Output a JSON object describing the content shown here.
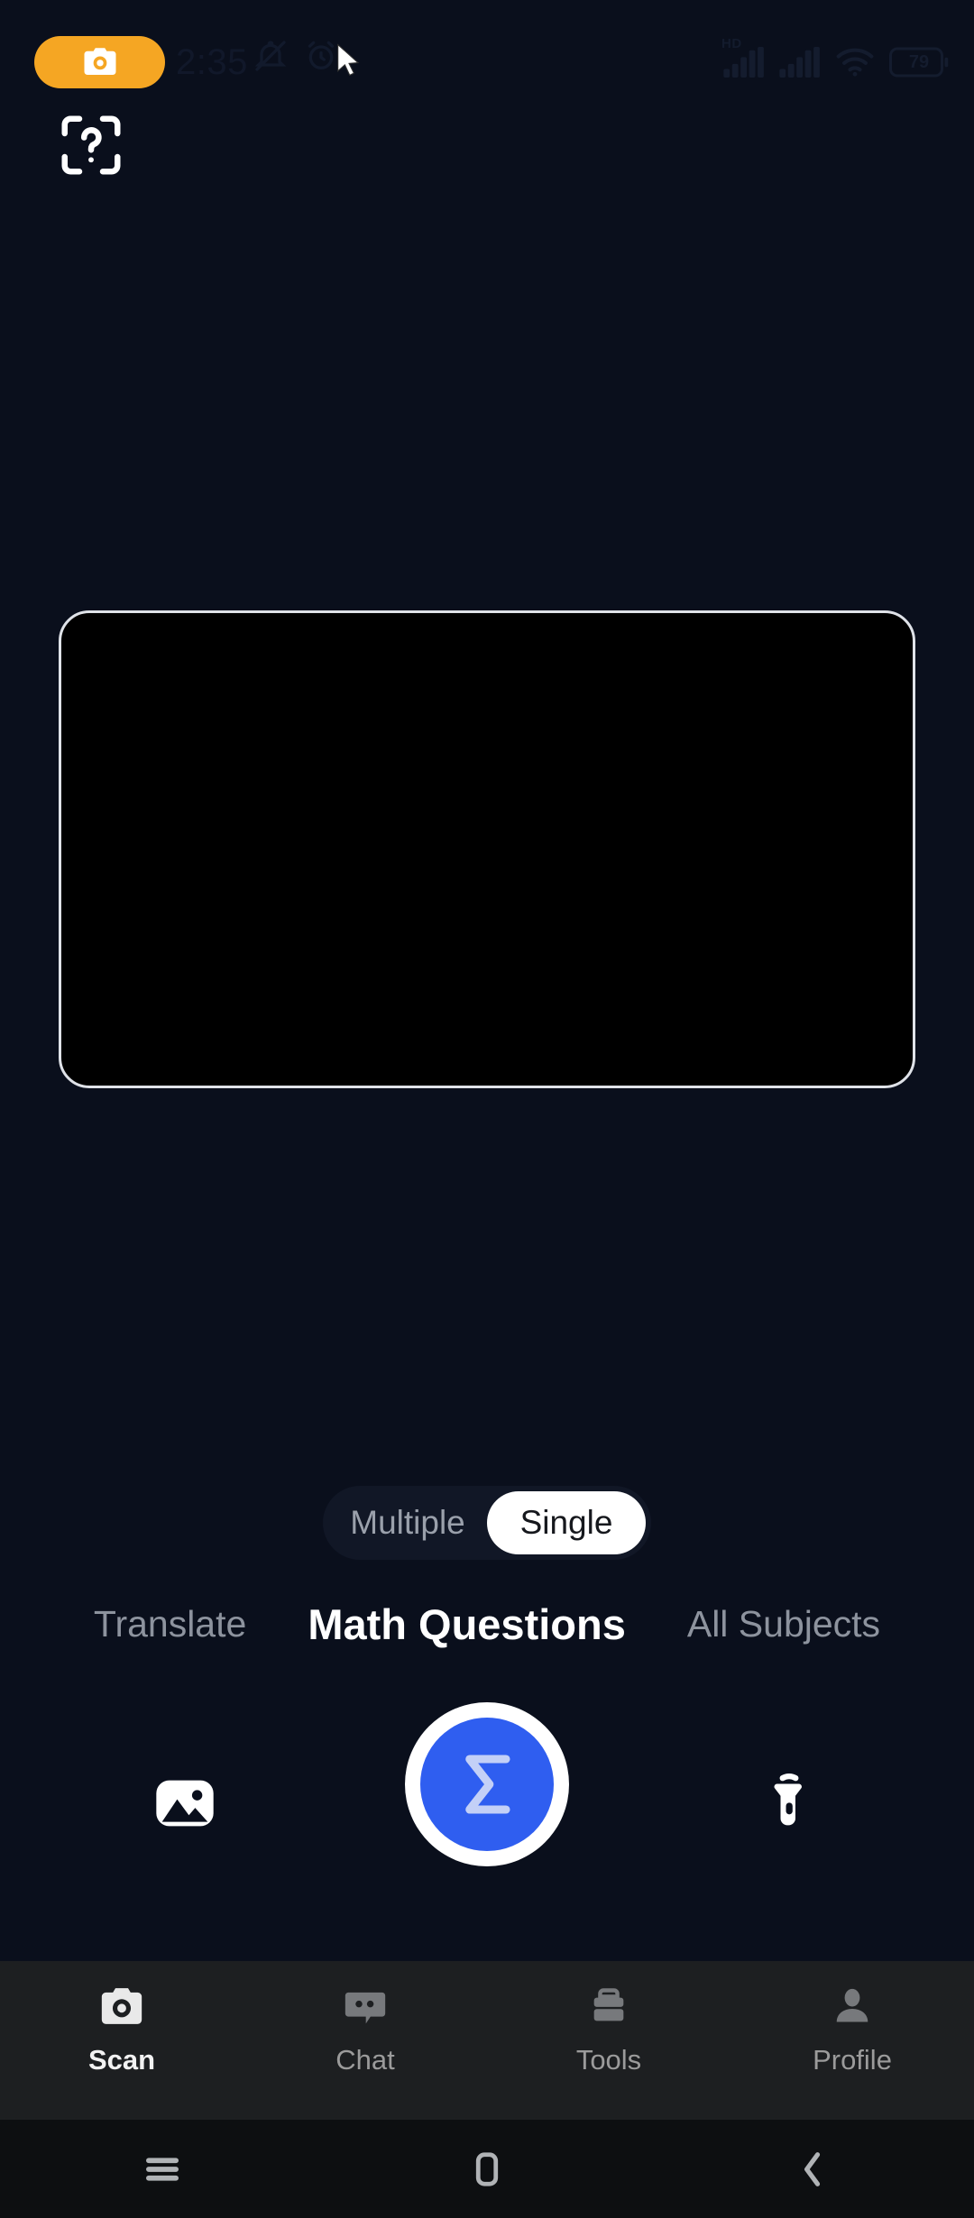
{
  "statusbar": {
    "time": "2:35",
    "camera_badge_icon": "camera-icon",
    "silent_icon": "bell-off-icon",
    "alarm_icon": "alarm-clock-icon",
    "cursor_icon": "mouse-cursor-icon",
    "hd_label": "HD",
    "signal_icon": "cellular-signal-icon",
    "signal2_icon": "cellular-signal-2-icon",
    "wifi_icon": "wifi-icon",
    "battery_level": "79"
  },
  "overlay": {
    "scan_help_icon": "scan-question-icon"
  },
  "viewfinder": {
    "frame_name": "camera-viewfinder-frame"
  },
  "capture_mode_toggle": {
    "options": [
      {
        "label": "Multiple",
        "active": false
      },
      {
        "label": "Single",
        "active": true
      }
    ]
  },
  "subject_modes": [
    {
      "label": "Translate",
      "active": false
    },
    {
      "label": "Math Questions",
      "active": true
    },
    {
      "label": "All Subjects",
      "active": false
    }
  ],
  "capture_row": {
    "gallery_icon": "gallery-image-icon",
    "shutter_icon": "sigma-icon",
    "shutter_glyph": "Σ",
    "torch_icon": "flashlight-icon",
    "shutter_color": "#2f5ef0",
    "shutter_glyph_color": "#c3d0f7"
  },
  "bottom_nav": [
    {
      "label": "Scan",
      "icon": "camera-icon",
      "active": true
    },
    {
      "label": "Chat",
      "icon": "chat-bubble-icon",
      "active": false
    },
    {
      "label": "Tools",
      "icon": "toolbox-icon",
      "active": false
    },
    {
      "label": "Profile",
      "icon": "person-icon",
      "active": false
    }
  ],
  "system_nav": [
    {
      "name": "recents-button",
      "icon": "menu-lines-icon"
    },
    {
      "name": "home-button",
      "icon": "home-rect-icon"
    },
    {
      "name": "back-button",
      "icon": "chevron-left-icon"
    }
  ],
  "colors": {
    "app_background": "#0a0f1c",
    "accent_orange": "#f5a623",
    "accent_blue": "#2f5ef0",
    "nav_background": "#1d1f21"
  }
}
